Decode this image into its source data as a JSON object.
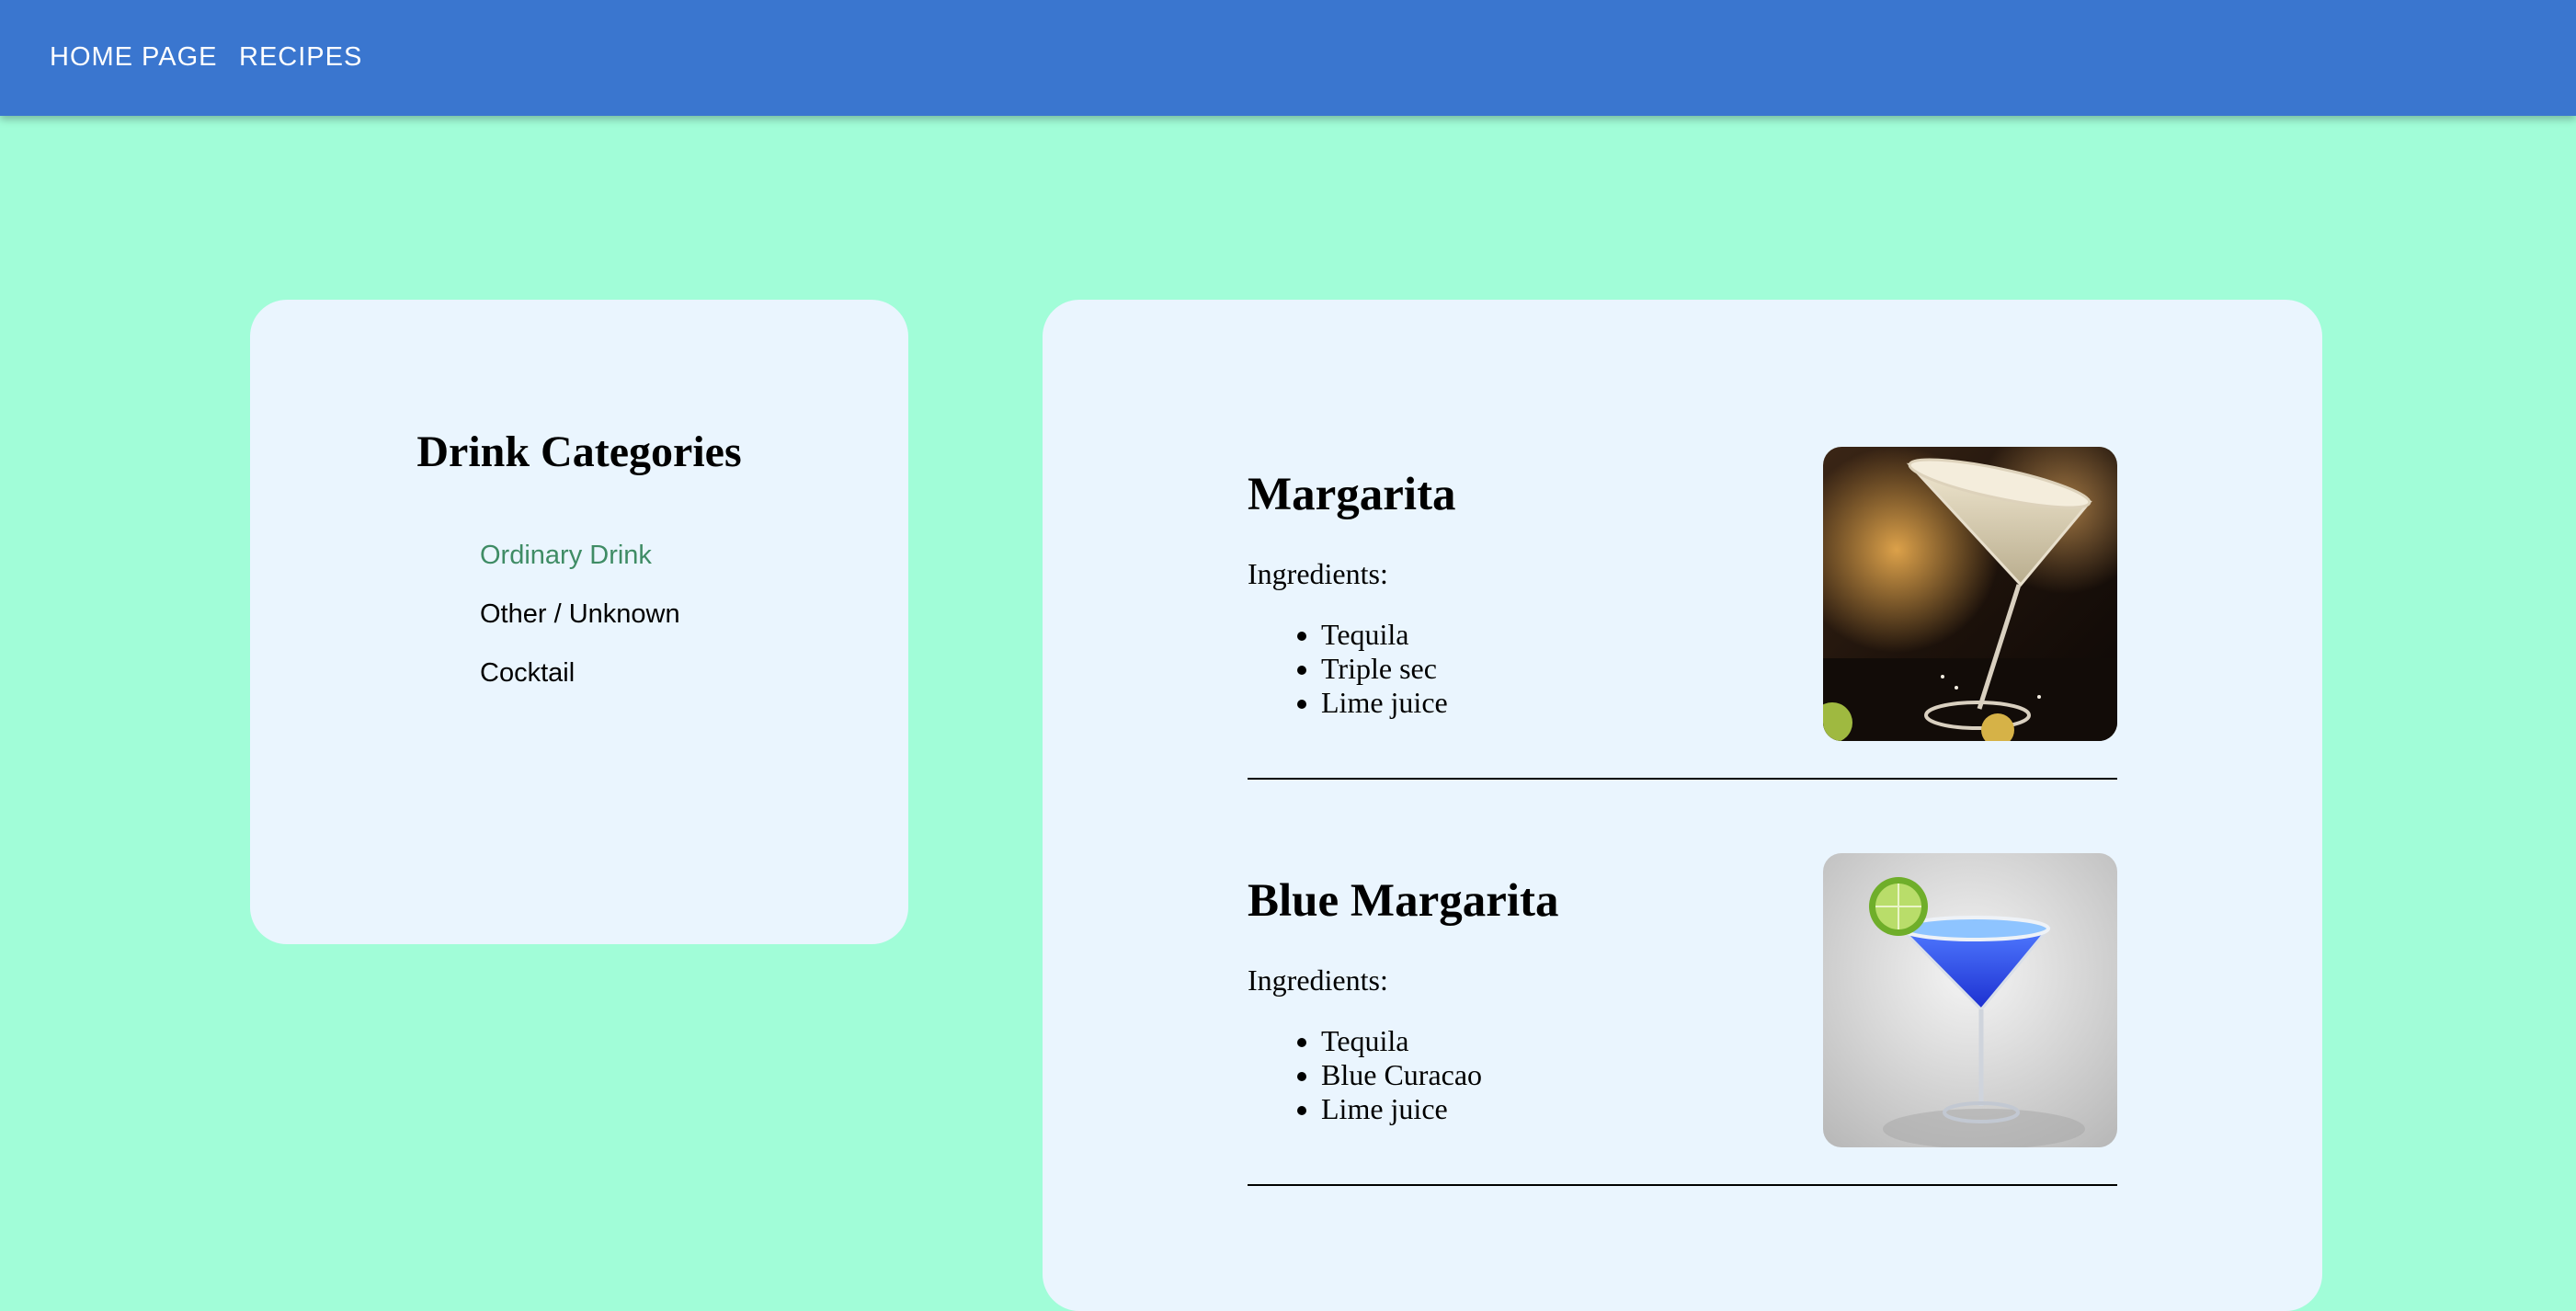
{
  "nav": {
    "home_label": "HOME PAGE",
    "recipes_label": "RECIPES"
  },
  "categories": {
    "title": "Drink Categories",
    "items": [
      {
        "label": "Ordinary Drink",
        "active": true
      },
      {
        "label": "Other / Unknown",
        "active": false
      },
      {
        "label": "Cocktail",
        "active": false
      }
    ]
  },
  "recipes": [
    {
      "name": "Margarita",
      "ingredients_label": "Ingredients:",
      "ingredients": [
        "Tequila",
        "Triple sec",
        "Lime juice"
      ],
      "image": "margarita-cocktail-photo"
    },
    {
      "name": "Blue Margarita",
      "ingredients_label": "Ingredients:",
      "ingredients": [
        "Tequila",
        "Blue Curacao",
        "Lime juice"
      ],
      "image": "blue-margarita-cocktail-photo"
    }
  ],
  "colors": {
    "page_background": "#a1fdd8",
    "navbar": "#3a76cf",
    "card_background": "#eaf5fe",
    "active_category": "#3f8c65"
  }
}
